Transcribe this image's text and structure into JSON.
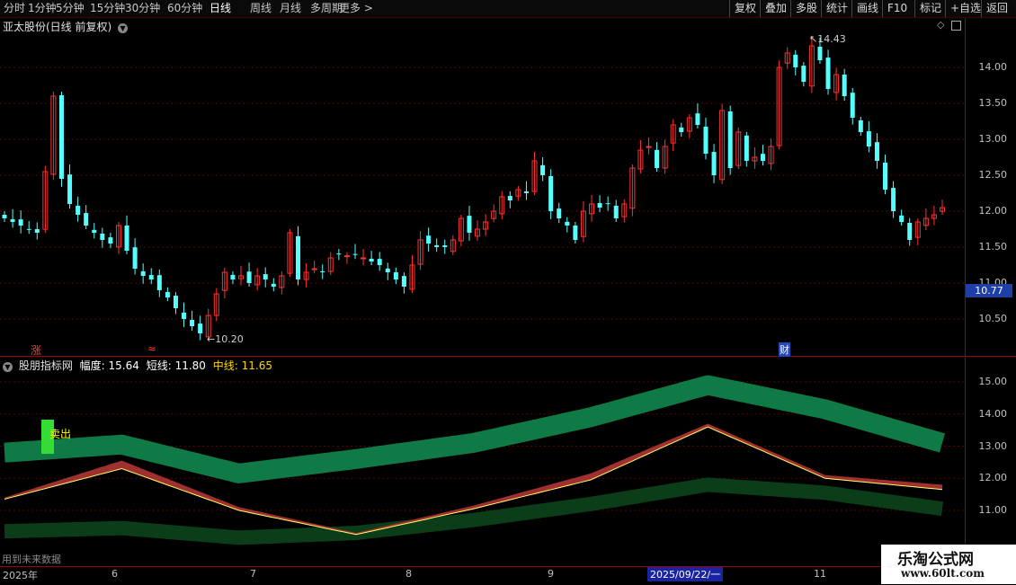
{
  "toolbar": {
    "periods": [
      "分时",
      "1分钟",
      "5分钟",
      "15分钟",
      "30分钟",
      "60分钟",
      "日线",
      "周线",
      "月线",
      "多周期",
      "更多 >"
    ],
    "active": "日线",
    "right_buttons": [
      "复权",
      "叠加",
      "多股",
      "统计",
      "画线",
      "F10",
      "标记",
      "+自选",
      "返回"
    ]
  },
  "main": {
    "title": "亚太股份(日线 前复权)",
    "high_label": "14.43",
    "low_label": "10.20",
    "price_badge": "10.77",
    "price_ticks": [
      "14.00",
      "13.50",
      "13.00",
      "12.50",
      "12.00",
      "11.50",
      "11.00",
      "10.50"
    ],
    "markers": {
      "zhang": "涨",
      "xiu": "≈",
      "cai": "财"
    }
  },
  "indicator": {
    "name": "股朋指标网",
    "fudu_label": "幅度: 15.64",
    "duan_label": "短线: 11.80",
    "zhong_label": "中线: 11.65",
    "signal": "卖出",
    "ticks": [
      "15.00",
      "14.00",
      "13.00",
      "12.00",
      "11.00"
    ],
    "note": "用到未来数据"
  },
  "axis": {
    "labels": [
      "2025年",
      "6",
      "7",
      "8",
      "9",
      "11"
    ],
    "cursor_date": "2025/09/22/一"
  },
  "watermark": {
    "name": "乐淘公式网",
    "url": "www.60lt.com"
  },
  "colors": {
    "up": "#ff3232",
    "down": "#54ffff",
    "band_upper": "#0f7a45",
    "band_lower": "#0b3d18",
    "fill": "#a03030"
  },
  "chart_data": {
    "type": "candlestick",
    "daily_closes": [
      11.9,
      11.85,
      11.8,
      11.75,
      11.7,
      12.55,
      13.6,
      12.45,
      12.1,
      11.95,
      11.8,
      11.7,
      11.6,
      11.55,
      11.8,
      11.45,
      11.2,
      11.1,
      11.05,
      10.9,
      10.8,
      10.65,
      10.5,
      10.4,
      10.3,
      10.55,
      10.85,
      11.15,
      11.05,
      11.1,
      11.0,
      11.1,
      11.05,
      10.95,
      11.1,
      11.7,
      11.05,
      11.15,
      11.2,
      11.15,
      11.35,
      11.4,
      11.38,
      11.4,
      11.35,
      11.3,
      11.25,
      11.15,
      11.05,
      10.95,
      11.25,
      11.6,
      11.55,
      11.5,
      11.5,
      11.6,
      11.9,
      11.7,
      11.75,
      11.85,
      12.0,
      12.2,
      12.15,
      12.3,
      12.25,
      12.7,
      12.5,
      12.0,
      11.9,
      11.8,
      11.6,
      12.0,
      12.1,
      12.05,
      12.1,
      11.9,
      12.1,
      12.6,
      12.85,
      12.9,
      12.6,
      12.9,
      13.2,
      13.1,
      13.3,
      13.2,
      12.8,
      12.5,
      13.4,
      12.6,
      13.1,
      12.7,
      12.75,
      12.7,
      12.9,
      14.0,
      14.2,
      14.0,
      13.8,
      14.3,
      14.1,
      13.7,
      13.9,
      13.6,
      13.3,
      13.1,
      12.9,
      12.7,
      12.3,
      12.0,
      11.85,
      11.6,
      11.85,
      11.9,
      11.95,
      12.05
    ],
    "band_upper": [
      12.8,
      13.05,
      12.15,
      12.6,
      13.1,
      13.9,
      14.9,
      14.15,
      13.1
    ],
    "band_lower": [
      10.35,
      10.45,
      10.15,
      10.3,
      10.7,
      11.2,
      11.8,
      11.55,
      11.05
    ],
    "line_short": [
      11.4,
      12.55,
      11.1,
      10.3,
      11.15,
      12.15,
      13.7,
      12.1,
      11.8
    ],
    "line_mid": [
      11.35,
      12.3,
      11.0,
      10.25,
      11.05,
      11.95,
      13.6,
      12.0,
      11.65
    ]
  }
}
